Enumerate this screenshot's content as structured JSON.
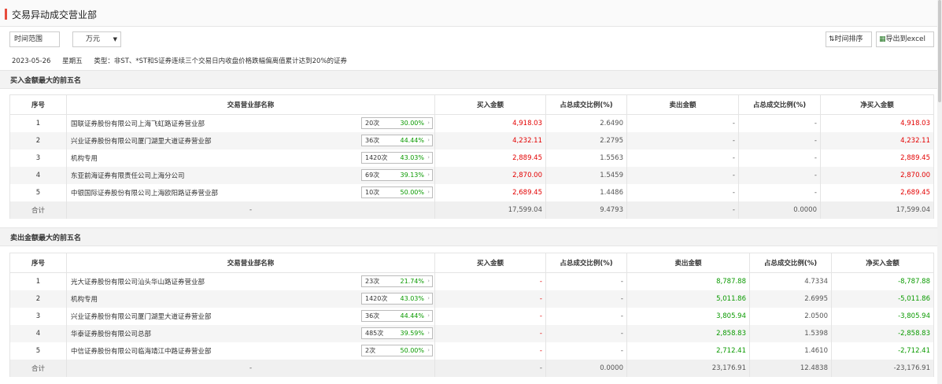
{
  "page": {
    "title": "交易异动成交营业部",
    "accent_color": "#e74c3c"
  },
  "toolbar": {
    "time_range_label": "时间范围",
    "unit_value": "万元",
    "sort_label": "时间排序",
    "export_label": "导出到excel"
  },
  "info": {
    "date": "2023-05-26",
    "weekday": "星期五",
    "type_text": "类型：非ST、*ST和S证券连续三个交易日内收盘价格跌幅偏离值累计达到20%的证券"
  },
  "columns": [
    "序号",
    "交易营业部名称",
    "买入金额",
    "占总成交比例(%)",
    "卖出金额",
    "占总成交比例(%)",
    "净买入金额"
  ],
  "buy_section": {
    "title": "买入金额最大的前五名",
    "rows": [
      {
        "idx": "1",
        "name": "国联证券股份有限公司上海飞虹路证券营业部",
        "count": "20次",
        "pct": "30.00%",
        "buy": "4,918.03",
        "buy_ratio": "2.6490",
        "sell": "-",
        "sell_ratio": "-",
        "net": "4,918.03"
      },
      {
        "idx": "2",
        "name": "兴业证券股份有限公司厦门湖里大道证券营业部",
        "count": "36次",
        "pct": "44.44%",
        "buy": "4,232.11",
        "buy_ratio": "2.2795",
        "sell": "-",
        "sell_ratio": "-",
        "net": "4,232.11"
      },
      {
        "idx": "3",
        "name": "机构专用",
        "count": "1420次",
        "pct": "43.03%",
        "buy": "2,889.45",
        "buy_ratio": "1.5563",
        "sell": "-",
        "sell_ratio": "-",
        "net": "2,889.45"
      },
      {
        "idx": "4",
        "name": "东亚前海证券有限责任公司上海分公司",
        "count": "69次",
        "pct": "39.13%",
        "buy": "2,870.00",
        "buy_ratio": "1.5459",
        "sell": "-",
        "sell_ratio": "-",
        "net": "2,870.00"
      },
      {
        "idx": "5",
        "name": "中银国际证券股份有限公司上海欧阳路证券营业部",
        "count": "10次",
        "pct": "50.00%",
        "buy": "2,689.45",
        "buy_ratio": "1.4486",
        "sell": "-",
        "sell_ratio": "-",
        "net": "2,689.45"
      }
    ],
    "total": {
      "label": "合计",
      "name": "-",
      "buy": "17,599.04",
      "buy_ratio": "9.4793",
      "sell": "-",
      "sell_ratio": "0.0000",
      "net": "17,599.04"
    }
  },
  "sell_section": {
    "title": "卖出金额最大的前五名",
    "rows": [
      {
        "idx": "1",
        "name": "光大证券股份有限公司汕头华山路证券营业部",
        "count": "23次",
        "pct": "21.74%",
        "buy": "-",
        "buy_ratio": "-",
        "sell": "8,787.88",
        "sell_ratio": "4.7334",
        "net": "-8,787.88"
      },
      {
        "idx": "2",
        "name": "机构专用",
        "count": "1420次",
        "pct": "43.03%",
        "buy": "-",
        "buy_ratio": "-",
        "sell": "5,011.86",
        "sell_ratio": "2.6995",
        "net": "-5,011.86"
      },
      {
        "idx": "3",
        "name": "兴业证券股份有限公司厦门湖里大道证券营业部",
        "count": "36次",
        "pct": "44.44%",
        "buy": "-",
        "buy_ratio": "-",
        "sell": "3,805.94",
        "sell_ratio": "2.0500",
        "net": "-3,805.94"
      },
      {
        "idx": "4",
        "name": "华泰证券股份有限公司总部",
        "count": "485次",
        "pct": "39.59%",
        "buy": "-",
        "buy_ratio": "-",
        "sell": "2,858.83",
        "sell_ratio": "1.5398",
        "net": "-2,858.83"
      },
      {
        "idx": "5",
        "name": "中信证券股份有限公司临海靖江中路证券营业部",
        "count": "2次",
        "pct": "50.00%",
        "buy": "-",
        "buy_ratio": "-",
        "sell": "2,712.41",
        "sell_ratio": "1.4610",
        "net": "-2,712.41"
      }
    ],
    "total": {
      "label": "合计",
      "name": "-",
      "buy": "-",
      "buy_ratio": "0.0000",
      "sell": "23,176.91",
      "sell_ratio": "12.4838",
      "net": "-23,176.91"
    }
  }
}
